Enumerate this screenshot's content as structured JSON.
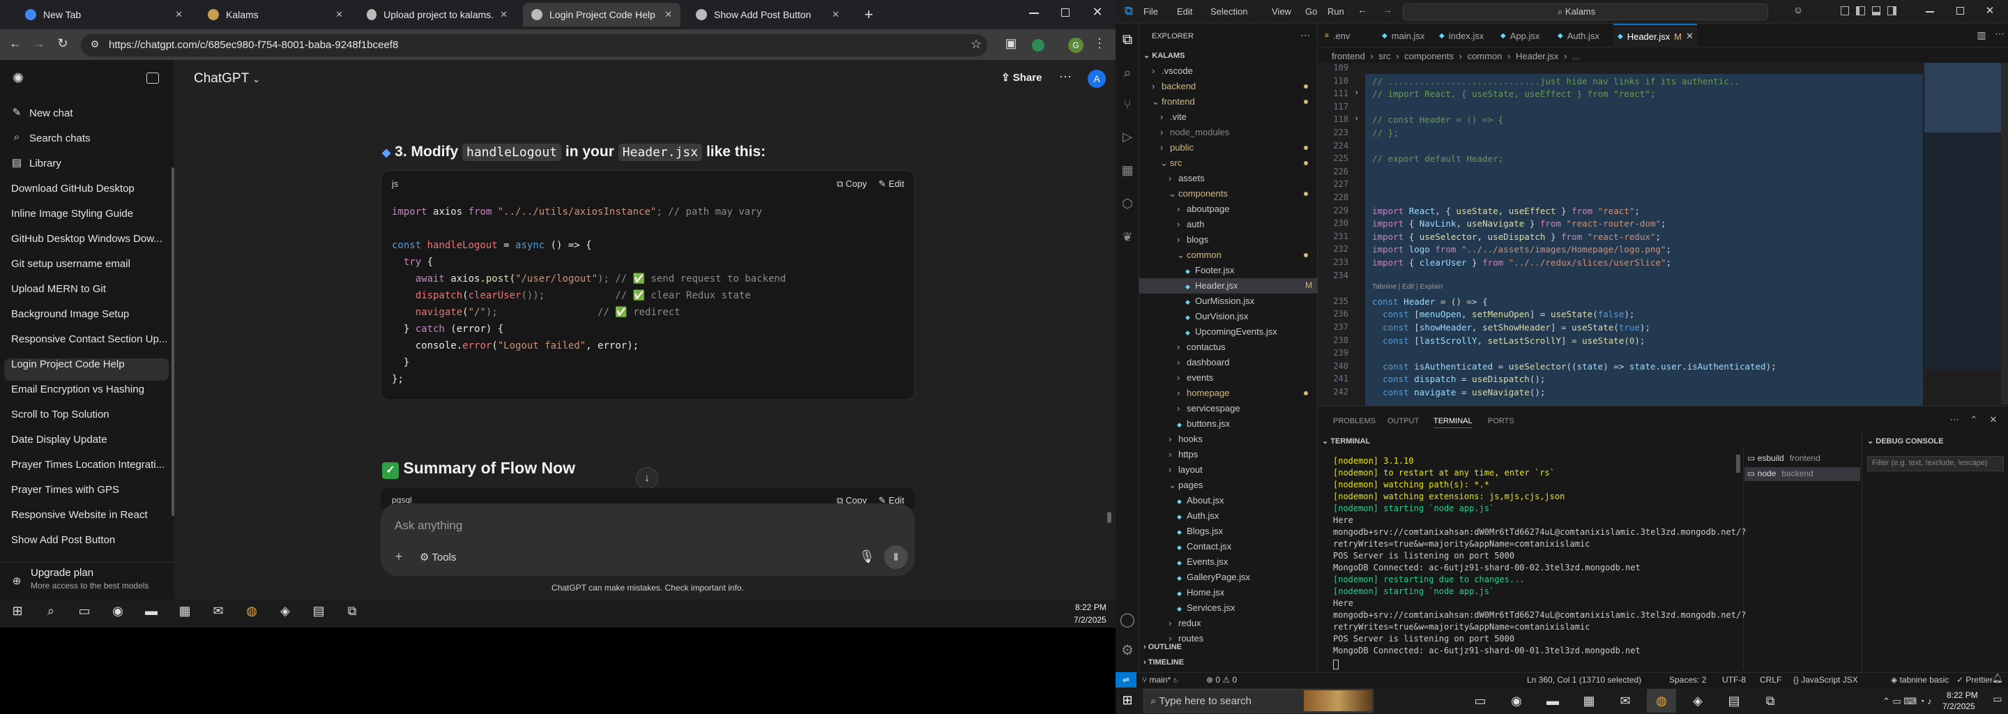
{
  "browser": {
    "tabs": [
      {
        "title": "New Tab",
        "color": "#4285f4"
      },
      {
        "title": "Kalams",
        "color": "#c8a050"
      },
      {
        "title": "Upload project to kalams.org",
        "color": "#bbbbbb"
      },
      {
        "title": "Login Project Code Help",
        "color": "#bbbbbb"
      },
      {
        "title": "Show Add Post Button",
        "color": "#bbbbbb"
      }
    ],
    "new_tab": "+",
    "url": "https://chatgpt.com/c/685ec980-f754-8001-baba-9248f1bceef8"
  },
  "chatgpt": {
    "new_chat": "New chat",
    "search": "Search chats",
    "library": "Library",
    "history": [
      "Download GitHub Desktop",
      "Inline Image Styling Guide",
      "GitHub Desktop Windows Dow...",
      "Git setup username email",
      "Upload MERN to Git",
      "Background Image Setup",
      "Responsive Contact Section Up...",
      "Login Project Code Help",
      "Email Encryption vs Hashing",
      "Scroll to Top Solution",
      "Date Display Update",
      "Prayer Times Location Integrati...",
      "Prayer Times with GPS",
      "Responsive Website in React",
      "Show Add Post Button"
    ],
    "upgrade": "Upgrade plan",
    "upgrade_sub": "More access to the best models",
    "model": "ChatGPT",
    "share": "Share",
    "avatar": "A",
    "step_title_pre": "3. Modify ",
    "step_code1": "handleLogout",
    "step_mid": " in your ",
    "step_code2": "Header.jsx",
    "step_post": " like this:",
    "lang": "js",
    "copy": "Copy",
    "edit": "Edit",
    "code": [
      [
        {
          "t": "import ",
          "c": "#c586c0"
        },
        {
          "t": "axios ",
          "c": "#e8e8e8"
        },
        {
          "t": "from ",
          "c": "#c586c0"
        },
        {
          "t": "\"../../utils/axiosInstance\"",
          "c": "#ce9178"
        },
        {
          "t": "; // path may vary",
          "c": "#8b8b8b"
        }
      ],
      [],
      [
        {
          "t": "const ",
          "c": "#569cd6"
        },
        {
          "t": "handleLogout",
          "c": "#f07178"
        },
        {
          "t": " = ",
          "c": "#e8e8e8"
        },
        {
          "t": "async ",
          "c": "#569cd6"
        },
        {
          "t": "() => {",
          "c": "#e8e8e8"
        }
      ],
      [
        {
          "t": "  try ",
          "c": "#c586c0"
        },
        {
          "t": "{",
          "c": "#e8e8e8"
        }
      ],
      [
        {
          "t": "    await ",
          "c": "#c586c0"
        },
        {
          "t": "axios.",
          "c": "#e8e8e8"
        },
        {
          "t": "post",
          "c": "#dcdcaa"
        },
        {
          "t": "(",
          "c": "#e8e8e8"
        },
        {
          "t": "\"/user/logout\"",
          "c": "#ce9178"
        },
        {
          "t": "); // ",
          "c": "#8b8b8b"
        },
        {
          "t": "✅",
          "c": "#3fb950"
        },
        {
          "t": " send request to backend",
          "c": "#8b8b8b"
        }
      ],
      [
        {
          "t": "    dispatch",
          "c": "#f07178"
        },
        {
          "t": "(",
          "c": "#e8e8e8"
        },
        {
          "t": "clearUser",
          "c": "#f07178"
        },
        {
          "t": "());            // ",
          "c": "#8b8b8b"
        },
        {
          "t": "✅",
          "c": "#3fb950"
        },
        {
          "t": " clear Redux state",
          "c": "#8b8b8b"
        }
      ],
      [
        {
          "t": "    navigate",
          "c": "#f07178"
        },
        {
          "t": "(",
          "c": "#e8e8e8"
        },
        {
          "t": "\"/\"",
          "c": "#ce9178"
        },
        {
          "t": ");                 // ",
          "c": "#8b8b8b"
        },
        {
          "t": "✅",
          "c": "#3fb950"
        },
        {
          "t": " redirect",
          "c": "#8b8b8b"
        }
      ],
      [
        {
          "t": "  } ",
          "c": "#e8e8e8"
        },
        {
          "t": "catch ",
          "c": "#c586c0"
        },
        {
          "t": "(error) {",
          "c": "#e8e8e8"
        }
      ],
      [
        {
          "t": "    console.",
          "c": "#e8e8e8"
        },
        {
          "t": "error",
          "c": "#f07178"
        },
        {
          "t": "(",
          "c": "#e8e8e8"
        },
        {
          "t": "\"Logout failed\"",
          "c": "#ce9178"
        },
        {
          "t": ", error);",
          "c": "#e8e8e8"
        }
      ],
      [
        {
          "t": "  }",
          "c": "#e8e8e8"
        }
      ],
      [
        {
          "t": "};",
          "c": "#e8e8e8"
        }
      ]
    ],
    "summary": "Summary of Flow Now",
    "lang2": "pgsql",
    "input_placeholder": "Ask anything",
    "tools": "Tools",
    "disclaimer": "ChatGPT can make mistakes. Check important info."
  },
  "taskbar_left": {
    "time": "8:22 PM",
    "date": "7/2/2025"
  },
  "vscode": {
    "menu": [
      "File",
      "Edit",
      "Selection",
      "View",
      "Go",
      "Run"
    ],
    "search": "Kalams",
    "explorer_title": "EXPLORER",
    "root": "KALAMS",
    "tree": [
      {
        "name": ".vscode",
        "d": 1,
        "a": "›"
      },
      {
        "name": "backend",
        "d": 1,
        "a": "›",
        "dot": true
      },
      {
        "name": "frontend",
        "d": 1,
        "a": "⌄",
        "dot": true
      },
      {
        "name": ".vite",
        "d": 2,
        "a": "›"
      },
      {
        "name": "node_modules",
        "d": 2,
        "a": "›",
        "dim": true
      },
      {
        "name": "public",
        "d": 2,
        "a": "›",
        "dot": true
      },
      {
        "name": "src",
        "d": 2,
        "a": "⌄",
        "dot": true
      },
      {
        "name": "assets",
        "d": 3,
        "a": "›"
      },
      {
        "name": "components",
        "d": 3,
        "a": "⌄",
        "dot": true
      },
      {
        "name": "aboutpage",
        "d": 4,
        "a": "›"
      },
      {
        "name": "auth",
        "d": 4,
        "a": "›"
      },
      {
        "name": "blogs",
        "d": 4,
        "a": "›"
      },
      {
        "name": "common",
        "d": 4,
        "a": "⌄",
        "dot": true
      },
      {
        "name": "Footer.jsx",
        "d": 5,
        "a": ""
      },
      {
        "name": "Header.jsx",
        "d": 5,
        "a": "",
        "sel": true,
        "m": "M"
      },
      {
        "name": "OurMission.jsx",
        "d": 5,
        "a": ""
      },
      {
        "name": "OurVision.jsx",
        "d": 5,
        "a": ""
      },
      {
        "name": "UpcomingEvents.jsx",
        "d": 5,
        "a": ""
      },
      {
        "name": "contactus",
        "d": 4,
        "a": "›"
      },
      {
        "name": "dashboard",
        "d": 4,
        "a": "›"
      },
      {
        "name": "events",
        "d": 4,
        "a": "›"
      },
      {
        "name": "homepage",
        "d": 4,
        "a": "›",
        "dot": true
      },
      {
        "name": "servicespage",
        "d": 4,
        "a": "›"
      },
      {
        "name": "buttons.jsx",
        "d": 4,
        "a": ""
      },
      {
        "name": "hooks",
        "d": 3,
        "a": "›"
      },
      {
        "name": "https",
        "d": 3,
        "a": "›"
      },
      {
        "name": "layout",
        "d": 3,
        "a": "›"
      },
      {
        "name": "pages",
        "d": 3,
        "a": "⌄"
      },
      {
        "name": "About.jsx",
        "d": 4,
        "a": ""
      },
      {
        "name": "Auth.jsx",
        "d": 4,
        "a": ""
      },
      {
        "name": "Blogs.jsx",
        "d": 4,
        "a": ""
      },
      {
        "name": "Contact.jsx",
        "d": 4,
        "a": ""
      },
      {
        "name": "Events.jsx",
        "d": 4,
        "a": ""
      },
      {
        "name": "GalleryPage.jsx",
        "d": 4,
        "a": ""
      },
      {
        "name": "Home.jsx",
        "d": 4,
        "a": ""
      },
      {
        "name": "Services.jsx",
        "d": 4,
        "a": ""
      },
      {
        "name": "redux",
        "d": 3,
        "a": "›"
      },
      {
        "name": "routes",
        "d": 3,
        "a": "›"
      }
    ],
    "outline": "OUTLINE",
    "timeline": "TIMELINE",
    "tabs": [
      ".env",
      "main.jsx",
      "index.jsx",
      "App.jsx",
      "Auth.jsx",
      "Header.jsx"
    ],
    "active_tab_mark": "M",
    "breadcrumb": [
      "frontend",
      "src",
      "components",
      "common",
      "Header.jsx",
      "..."
    ],
    "lines": [
      {
        "n": "109",
        "t": ""
      },
      {
        "n": "110",
        "t": "// .............................just hide nav links if its authentic.."
      },
      {
        "n": "111",
        "t": "// import React, { useState, useEffect } from \"react\";"
      },
      {
        "n": "117",
        "t": ""
      },
      {
        "n": "118",
        "t": "// const Header = () => {"
      },
      {
        "n": "223",
        "t": "// };"
      },
      {
        "n": "224",
        "t": ""
      },
      {
        "n": "225",
        "t": "// export default Header;"
      },
      {
        "n": "226",
        "t": ""
      },
      {
        "n": "227",
        "t": ""
      },
      {
        "n": "228",
        "t": ""
      },
      {
        "n": "229",
        "t": "import React, { useState, useEffect } from \"react\";"
      },
      {
        "n": "230",
        "t": "import { NavLink, useNavigate } from \"react-router-dom\";"
      },
      {
        "n": "231",
        "t": "import { useSelector, useDispatch } from \"react-redux\";"
      },
      {
        "n": "232",
        "t": "import logo from \"../../assets/images/Homepage/logo.png\";"
      },
      {
        "n": "233",
        "t": "import { clearUser } from \"../../redux/slices/userSlice\";"
      },
      {
        "n": "234",
        "t": ""
      },
      {
        "n": "",
        "t": "Tabnine | Edit | Explain"
      },
      {
        "n": "235",
        "t": "const Header = () => {"
      },
      {
        "n": "236",
        "t": "  const [menuOpen, setMenuOpen] = useState(false);"
      },
      {
        "n": "237",
        "t": "  const [showHeader, setShowHeader] = useState(true);"
      },
      {
        "n": "238",
        "t": "  const [lastScrollY, setLastScrollY] = useState(0);"
      },
      {
        "n": "239",
        "t": ""
      },
      {
        "n": "240",
        "t": "  const isAuthenticated = useSelector((state) => state.user.isAuthenticated);"
      },
      {
        "n": "241",
        "t": "  const dispatch = useDispatch();"
      },
      {
        "n": "242",
        "t": "  const navigate = useNavigate();"
      }
    ],
    "panel_tabs": [
      "PROBLEMS",
      "OUTPUT",
      "TERMINAL",
      "PORTS"
    ],
    "terminal_title": "TERMINAL",
    "debug_title": "DEBUG CONSOLE",
    "debug_filter": "Filter (e.g. text, !exclude, \\escape)",
    "terms": [
      {
        "name": "esbuild",
        "sub": "frontend"
      },
      {
        "name": "node",
        "sub": "backend"
      }
    ],
    "terminal": [
      {
        "t": "[nodemon] 3.1.10",
        "c": "#e5e510"
      },
      {
        "t": "[nodemon] to restart at any time, enter `rs`",
        "c": "#e5e510"
      },
      {
        "t": "[nodemon] watching path(s): *.*",
        "c": "#e5e510"
      },
      {
        "t": "[nodemon] watching extensions: js,mjs,cjs,json",
        "c": "#e5e510"
      },
      {
        "t": "[nodemon] starting `node app.js`",
        "c": "#23d18b"
      },
      {
        "t": "Here",
        "c": "#cccccc"
      },
      {
        "t": "mongodb+srv://comtanixahsan:dW0Mr6tTd66274uL@comtanixislamic.3tel3zd.mongodb.net/?",
        "c": "#cccccc"
      },
      {
        "t": "retryWrites=true&w=majority&appName=comtanixislamic",
        "c": "#cccccc"
      },
      {
        "t": "POS Server is listening on port 5000",
        "c": "#cccccc"
      },
      {
        "t": "MongoDB Connected: ac-6utjz91-shard-00-02.3tel3zd.mongodb.net",
        "c": "#cccccc"
      },
      {
        "t": "[nodemon] restarting due to changes...",
        "c": "#23d18b"
      },
      {
        "t": "[nodemon] starting `node app.js`",
        "c": "#23d18b"
      },
      {
        "t": "Here",
        "c": "#cccccc"
      },
      {
        "t": "mongodb+srv://comtanixahsan:dW0Mr6tTd66274uL@comtanixislamic.3tel3zd.mongodb.net/?",
        "c": "#cccccc"
      },
      {
        "t": "retryWrites=true&w=majority&appName=comtanixislamic",
        "c": "#cccccc"
      },
      {
        "t": "POS Server is listening on port 5000",
        "c": "#cccccc"
      },
      {
        "t": "MongoDB Connected: ac-6utjz91-shard-00-01.3tel3zd.mongodb.net",
        "c": "#cccccc"
      }
    ],
    "status": {
      "branch": "main*",
      "errors": "0 ⚠ 0",
      "pos": "Ln 360, Col 1 (13710 selected)",
      "spaces": "Spaces: 2",
      "enc": "UTF-8",
      "eol": "CRLF",
      "lang": "JavaScript JSX",
      "tabnine": "tabnine basic",
      "prettier": "Prettier"
    }
  },
  "taskbar": {
    "search": "Type here to search",
    "time": "8:22 PM",
    "date": "7/2/2025"
  }
}
